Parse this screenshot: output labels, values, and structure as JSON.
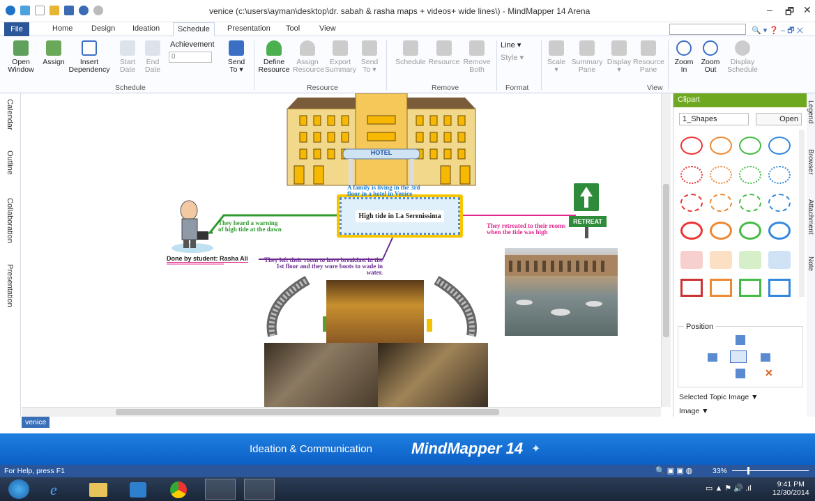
{
  "window": {
    "title": "venice (c:\\users\\ayman\\desktop\\dr. sabah & rasha maps + videos+ wide lines\\) - MindMapper 14 Arena",
    "controls": {
      "minimize": "–",
      "restore": "🗗",
      "close": "✕"
    }
  },
  "menu": {
    "file": "File",
    "tabs": [
      "Home",
      "Design",
      "Ideation",
      "Schedule",
      "Presentation",
      "Tool",
      "View"
    ],
    "active": "Schedule"
  },
  "ribbon": {
    "open_window": [
      "Open",
      "Window"
    ],
    "assign": "Assign",
    "insert_dependency": [
      "Insert",
      "Dependency"
    ],
    "start_date": [
      "Start",
      "Date"
    ],
    "end_date": [
      "End",
      "Date"
    ],
    "achievement_label": "Achievement",
    "achievement_value": "0",
    "send_to": [
      "Send",
      "To ▾"
    ],
    "define_resource": [
      "Define",
      "Resource"
    ],
    "assign_resource": [
      "Assign",
      "Resource"
    ],
    "export_summary": [
      "Export",
      "Summary"
    ],
    "send_to2": [
      "Send",
      "To ▾"
    ],
    "schedule": "Schedule",
    "resource": "Resource",
    "remove_both": [
      "Remove",
      "Both"
    ],
    "line": "Line ▾",
    "style": "Style ▾",
    "scale": [
      "Scale",
      "▾"
    ],
    "summary_pane": [
      "Summary",
      "Pane"
    ],
    "display": [
      "Display",
      "▾"
    ],
    "resource_pane": [
      "Resource",
      "Pane"
    ],
    "zoom_in": [
      "Zoom",
      "In"
    ],
    "zoom_out": [
      "Zoom",
      "Out"
    ],
    "display_schedule": [
      "Display",
      "Schedule"
    ],
    "groups": {
      "schedule": "Schedule",
      "resource": "Resource",
      "remove": "Remove",
      "format": "Format",
      "view": "View"
    }
  },
  "left_tabs": [
    "Calendar",
    "Outline",
    "Collaboration",
    "Presentation"
  ],
  "map": {
    "hotel_sign": "HOTEL",
    "central_topic": "High tide in La Serenissima",
    "topics": {
      "top": [
        "A family is living in the 3rd",
        "floor in a hotel in Venice"
      ],
      "left": [
        "They heard a warning",
        "of high tide at the dawn"
      ],
      "right": [
        "They retreated to their rooms",
        "when the tide was high"
      ],
      "bottom": [
        "They left their room to have breakfast in the",
        "1st floor and they wore boots to wade in",
        "water."
      ]
    },
    "author": "Done by student: Rasha Ali",
    "retreat_sign": "RETREAT",
    "colors": {
      "top": "#1f7fd6",
      "left": "#2e9a2e",
      "right": "#e0288f",
      "bottom": "#6b2c91"
    }
  },
  "sheet_tab": "venice",
  "banner": {
    "text": "Ideation & Communication",
    "brand": "MindMapper 14"
  },
  "status": {
    "help": "For Help, press F1",
    "zoom": "33%"
  },
  "clipart": {
    "title": "Clipart",
    "category": "1_Shapes",
    "open_button": "Open",
    "position_label": "Position",
    "selected_topic_image": "Selected Topic Image ▼",
    "image": "Image ▼"
  },
  "right_tabs": [
    "Legend",
    "Browser",
    "Attachment",
    "Note"
  ],
  "taskbar": {
    "time": "9:41 PM",
    "date": "12/30/2014"
  }
}
